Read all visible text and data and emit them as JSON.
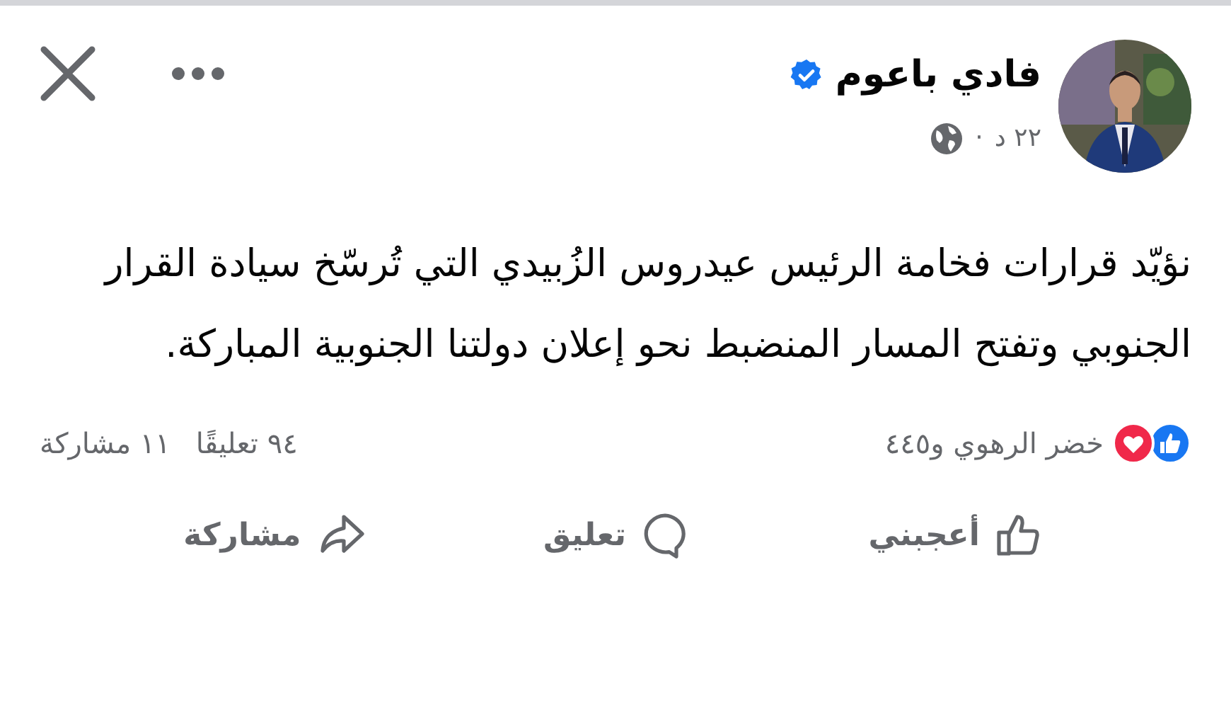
{
  "post": {
    "author": "فادي باعوم",
    "verified": true,
    "time": "٢٢ د",
    "separator": "·",
    "text": "نؤيّد قرارات فخامة الرئيس عيدروس الزُبيدي التي تُرسّخ سيادة القرار الجنوبي وتفتح المسار المنضبط نحو إعلان دولتنا الجنوبية المباركة."
  },
  "stats": {
    "reactions": "خضر الرهوي و٤٤٥",
    "comments": "٩٤ تعليقًا",
    "shares": "١١ مشاركة"
  },
  "actions": [
    {
      "kind": "like",
      "label": "أعجبني"
    },
    {
      "kind": "comment",
      "label": "تعليق"
    },
    {
      "kind": "share",
      "label": "مشاركة"
    }
  ]
}
